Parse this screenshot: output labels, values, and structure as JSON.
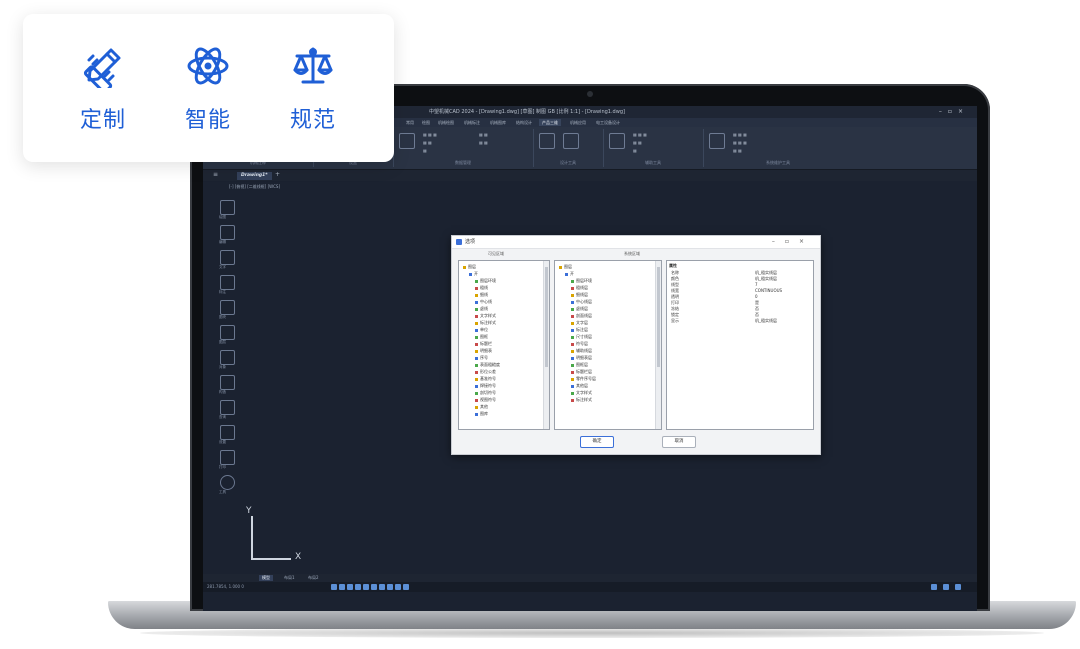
{
  "features": [
    {
      "label": "定制",
      "icon": "pencil-ruler-icon"
    },
    {
      "label": "智能",
      "icon": "atom-icon"
    },
    {
      "label": "规范",
      "icon": "balance-scale-icon"
    }
  ],
  "cad": {
    "window_title": "中望机械CAD 2024 - [Drawing1.dwg] [草图] 制图 GB [比例 1:1] - [Drawing1.dwg]",
    "ribbon_tabs": [
      "常用",
      "绘图",
      "机械绘图",
      "机械标注",
      "机械图库",
      "结构设计",
      "产品三维",
      "机械应用",
      "电工设备设计"
    ],
    "ribbon_active_tab": "产品三维",
    "ribbon_groups": [
      "机械注释",
      "设置",
      "数据管理",
      "设计工具",
      "辅助工具",
      "系统维护工具"
    ],
    "doc_tab": "Drawing1*",
    "view_label": "[-] [俯视] [二维线框] [WCS]",
    "left_tools": [
      "绘图",
      "编辑",
      "文字",
      "标注",
      "图块",
      "图层",
      "对象",
      "构造",
      "查询",
      "设置",
      "打印",
      "工具",
      "设置"
    ],
    "ucs": {
      "y": "Y",
      "x": "X"
    },
    "layout_tabs": [
      "模型",
      "布局1",
      "布局2"
    ],
    "status_coords": "281.7854, 1.000  0"
  },
  "dialog": {
    "title": "选项",
    "left_panel_title": "可见区域",
    "middle_panel_title": "系统区域",
    "left_tree": [
      "图层",
      "开",
      "图层环境",
      "粗线",
      "细线",
      "中心线",
      "虚线",
      "文字样式",
      "标注样式",
      "单位",
      "图框",
      "标题栏",
      "明细表",
      "序号",
      "表面粗糙度",
      "形位公差",
      "基准符号",
      "焊接符号",
      "剖切符号",
      "视图符号",
      "其他",
      "图库"
    ],
    "middle_tree": [
      "图层",
      "开",
      "图层环境",
      "粗线层",
      "细线层",
      "中心线层",
      "虚线层",
      "剖面线层",
      "文字层",
      "标注层",
      "尺寸线层",
      "符号层",
      "辅助线层",
      "明细表层",
      "图框层",
      "标题栏层",
      "零件序号层",
      "其他层",
      "文字样式",
      "标注样式"
    ],
    "properties_header": "属性",
    "properties": [
      {
        "key": "名称",
        "value": "机_粗实线层"
      },
      {
        "key": "颜色",
        "value": "机_粗实线层"
      },
      {
        "key": "线型",
        "value": "7"
      },
      {
        "key": "线宽",
        "value": "CONTINUOUS"
      },
      {
        "key": "透明",
        "value": "0"
      },
      {
        "key": "打印",
        "value": "是"
      },
      {
        "key": "冻结",
        "value": "否"
      },
      {
        "key": "锁定",
        "value": "否"
      },
      {
        "key": "显示",
        "value": "机_粗实线层"
      }
    ],
    "ok_label": "确定",
    "cancel_label": "取消"
  }
}
